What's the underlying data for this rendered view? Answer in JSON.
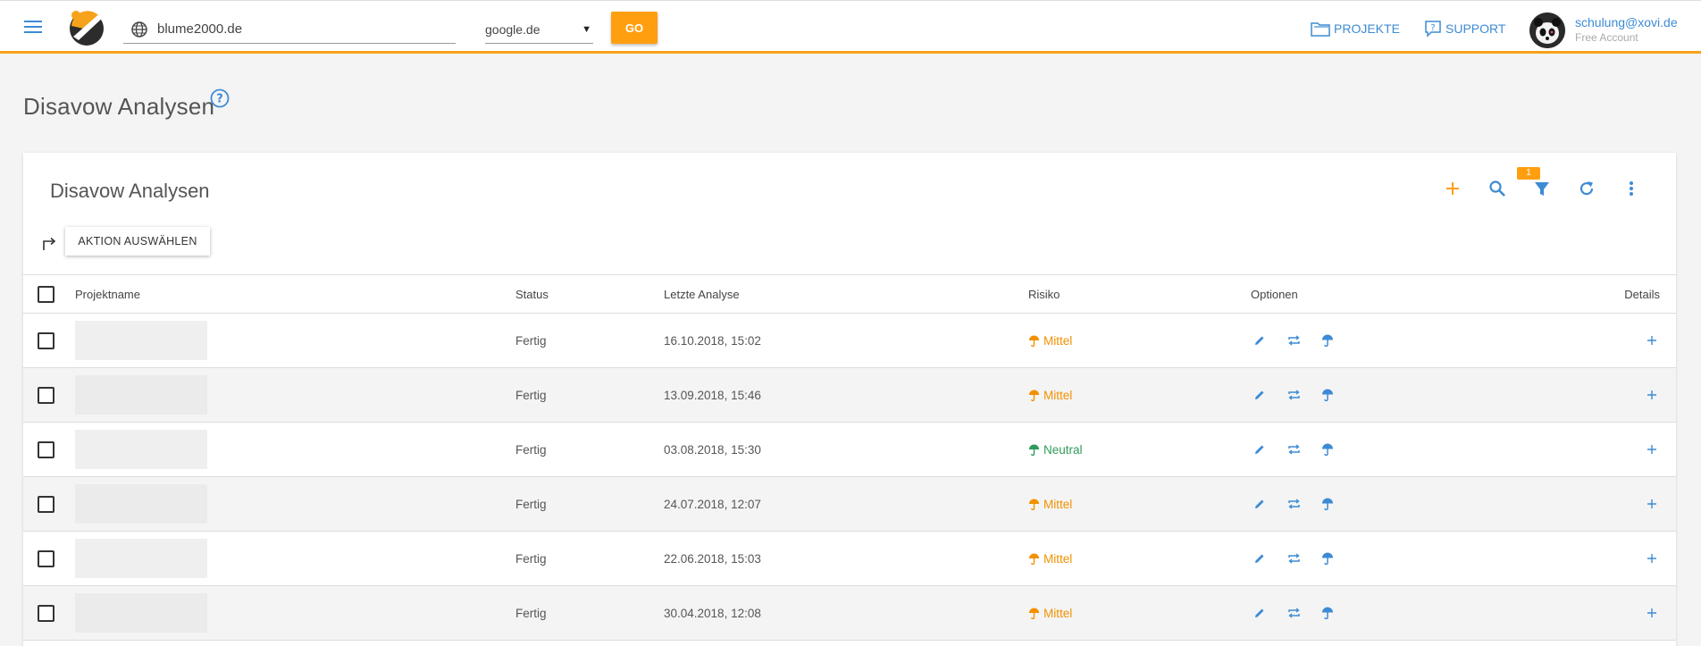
{
  "header": {
    "url_value": "blume2000.de",
    "search_engine": "google.de",
    "go_label": "GO",
    "nav_projects": "PROJEKTE",
    "nav_support": "SUPPORT",
    "user_email": "schulung@xovi.de",
    "user_plan": "Free Account"
  },
  "page": {
    "title": "Disavow Analysen"
  },
  "card": {
    "title": "Disavow Analysen",
    "action_button": "AKTION AUSWÄHLEN",
    "filter_badge": "1"
  },
  "table": {
    "columns": {
      "name": "Projektname",
      "status": "Status",
      "date": "Letzte Analyse",
      "risk": "Risiko",
      "options": "Optionen",
      "details": "Details"
    },
    "rows": [
      {
        "status": "Fertig",
        "date": "16.10.2018, 15:02",
        "risk": "Mittel",
        "risk_color": "#f29100"
      },
      {
        "status": "Fertig",
        "date": "13.09.2018, 15:46",
        "risk": "Mittel",
        "risk_color": "#f29100"
      },
      {
        "status": "Fertig",
        "date": "03.08.2018, 15:30",
        "risk": "Neutral",
        "risk_color": "#2e9b5a"
      },
      {
        "status": "Fertig",
        "date": "24.07.2018, 12:07",
        "risk": "Mittel",
        "risk_color": "#f29100"
      },
      {
        "status": "Fertig",
        "date": "22.06.2018, 15:03",
        "risk": "Mittel",
        "risk_color": "#f29100"
      },
      {
        "status": "Fertig",
        "date": "30.04.2018, 12:08",
        "risk": "Mittel",
        "risk_color": "#f29100"
      }
    ]
  },
  "colors": {
    "accent": "#ff9f0f",
    "link": "#3d8bd4"
  },
  "icons": [
    "menu-icon",
    "globe-icon",
    "folder-icon",
    "support-icon",
    "help-icon",
    "add-icon",
    "search-icon",
    "filter-icon",
    "refresh-icon",
    "more-icon",
    "action-arrow-icon",
    "edit-icon",
    "repeat-icon",
    "umbrella-icon",
    "plus-icon"
  ]
}
